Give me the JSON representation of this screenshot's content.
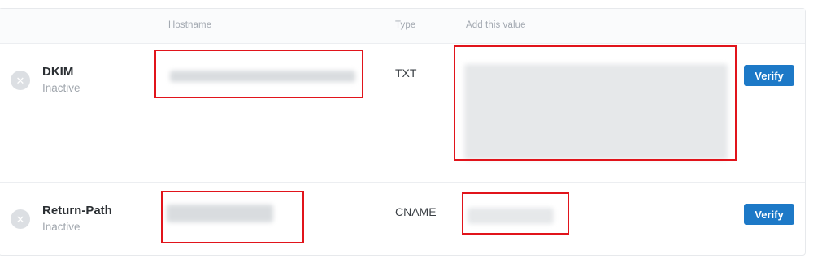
{
  "table": {
    "columns": {
      "hostname": "Hostname",
      "type": "Type",
      "value": "Add this value"
    },
    "rows": [
      {
        "name": "DKIM",
        "status": "Inactive",
        "status_icon": "x-circle-icon",
        "type": "TXT",
        "verify_label": "Verify"
      },
      {
        "name": "Return-Path",
        "status": "Inactive",
        "status_icon": "x-circle-icon",
        "type": "CNAME",
        "verify_label": "Verify"
      }
    ]
  },
  "colors": {
    "verify_button": "#1d79c7",
    "annotation_box": "#e1141b",
    "inactive_icon": "#dcdfe3"
  }
}
